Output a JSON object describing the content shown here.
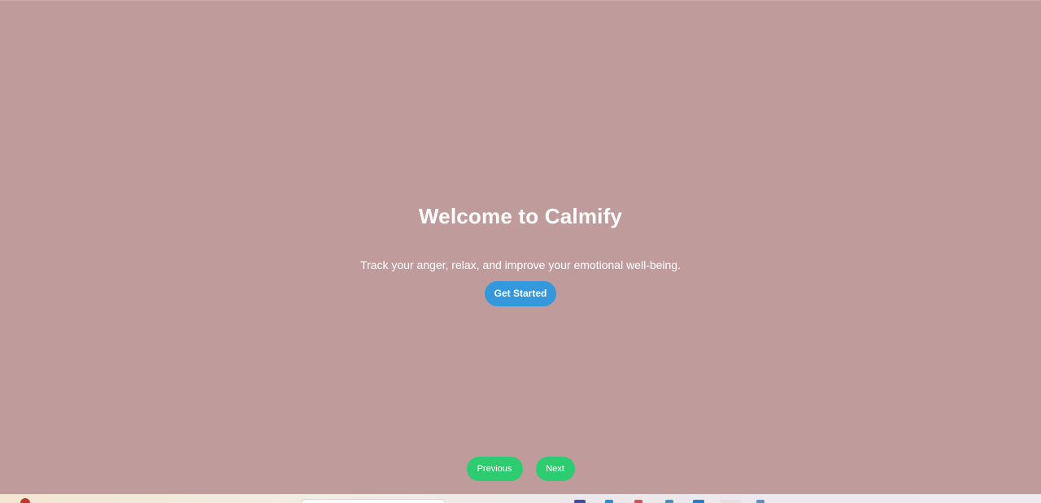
{
  "hero": {
    "title": "Welcome to Calmify",
    "subtitle": "Track your anger, relax, and improve your emotional well-being.",
    "cta_label": "Get Started"
  },
  "nav": {
    "previous_label": "Previous",
    "next_label": "Next"
  },
  "colors": {
    "background": "#bf9b9b",
    "cta": "#3498db",
    "nav_buttons": "#2ecc71",
    "text": "#ffffff"
  },
  "taskbar": {
    "icons": [
      "weather-icon",
      "search-box",
      "file-explorer-icon",
      "edge-icon",
      "mail-icon",
      "store-icon",
      "chrome-icon",
      "vscode-icon"
    ]
  }
}
